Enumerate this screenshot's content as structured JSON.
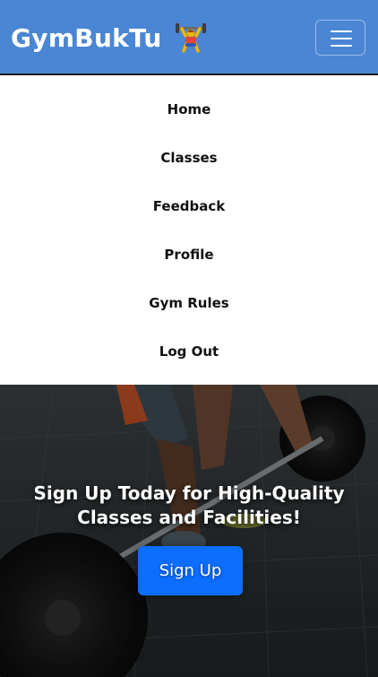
{
  "navbar": {
    "brand": "GymBukTu",
    "brand_icon": "weightlifter-icon",
    "toggle_icon": "hamburger-menu-icon"
  },
  "menu": {
    "items": [
      {
        "label": "Home"
      },
      {
        "label": "Classes"
      },
      {
        "label": "Feedback"
      },
      {
        "label": "Profile"
      },
      {
        "label": "Gym Rules"
      },
      {
        "label": "Log Out"
      }
    ]
  },
  "hero": {
    "title": "Sign Up Today for High-Quality Classes and Facilities!",
    "button": "Sign Up"
  },
  "colors": {
    "navbar": "#4a86d4",
    "button": "#0d6efd"
  }
}
